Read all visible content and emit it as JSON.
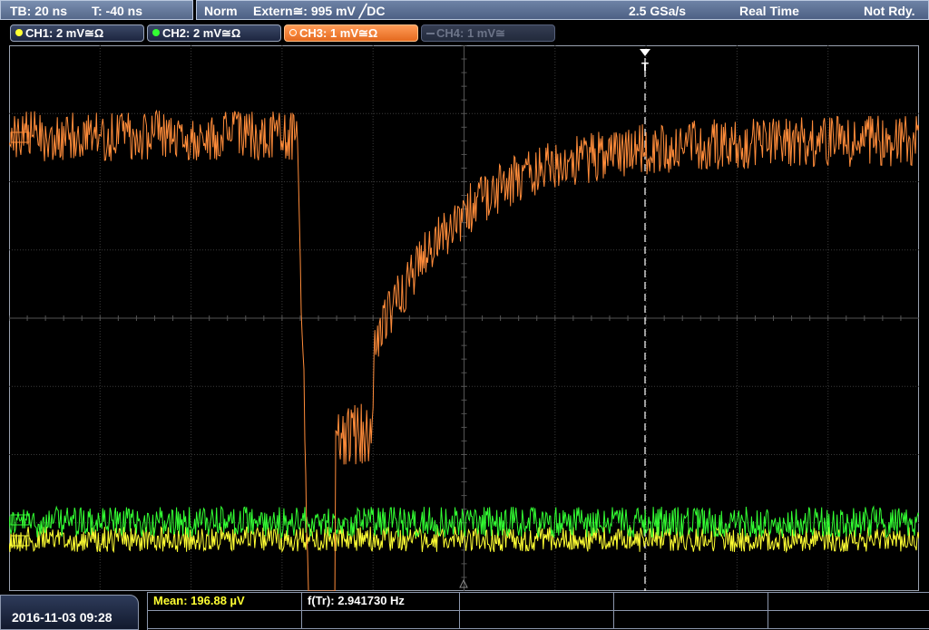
{
  "status": {
    "timebase": "TB: 20 ns",
    "trigger_time": "T: -40 ns",
    "acq_mode": "Norm",
    "trigger_source": "Extern≅: 995 mV ╱DC",
    "sample_rate": "2.5 GSa/s",
    "acq_type": "Real Time",
    "ready_state": "Not Rdy."
  },
  "channels": [
    {
      "label": "CH1: 2 mV≅Ω",
      "color": "#ffff33",
      "state": "on"
    },
    {
      "label": "CH2: 2 mV≅Ω",
      "color": "#33ff33",
      "state": "on"
    },
    {
      "label": "CH3: 1 mV≅Ω",
      "color": "#ff8c3a",
      "state": "selected"
    },
    {
      "label": "CH4: 1 mV≅",
      "color": "#6c7488",
      "state": "off"
    }
  ],
  "trigger_marker": "T",
  "bottom": {
    "datetime": "2016-11-03 09:28",
    "measurements": [
      {
        "label": "Mean: 196.88 µV",
        "color": "#ffff33"
      },
      {
        "label": "f(Tr): 2.941730 Hz",
        "color": "#ffffff"
      }
    ]
  },
  "colors": {
    "ch1": "#ffff33",
    "ch2": "#33ff33",
    "ch3": "#ff8c3a",
    "grid": "#3a3a3a",
    "bar": "#5c7096"
  }
}
